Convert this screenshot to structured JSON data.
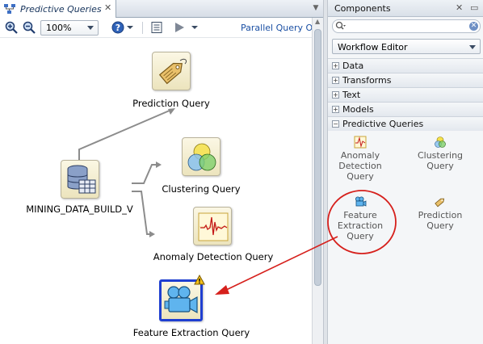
{
  "editor": {
    "tab_title": "Predictive Queries",
    "zoom": "100%",
    "parallel_link": "Parallel Query Of"
  },
  "nodes": {
    "prediction": "Prediction Query",
    "source": "MINING_DATA_BUILD_V",
    "clustering": "Clustering Query",
    "anomaly": "Anomaly Detection Query",
    "feature": "Feature Extraction Query"
  },
  "components": {
    "title": "Components",
    "selector": "Workflow Editor",
    "categories": [
      "Data",
      "Transforms",
      "Text",
      "Models",
      "Predictive Queries"
    ],
    "items": {
      "anomaly": [
        "Anomaly",
        "Detection",
        "Query"
      ],
      "clustering": [
        "Clustering",
        "Query"
      ],
      "feature": [
        "Feature",
        "Extraction",
        "Query"
      ],
      "prediction": [
        "Prediction",
        "Query"
      ]
    }
  },
  "colors": {
    "highlight_red": "#d6201c",
    "selection_blue": "#1f3fd1",
    "link_blue": "#1a4fa3"
  }
}
